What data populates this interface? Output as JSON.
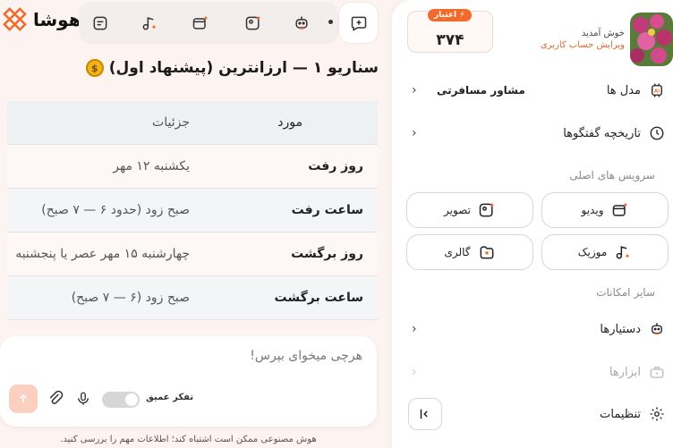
{
  "brand": {
    "name": "هوشا",
    "accent": "#f26a2b"
  },
  "toolbar": {
    "icons": [
      "chat-plus-icon",
      "robot-icon",
      "image-sparkle-icon",
      "video-sparkle-icon",
      "music-sparkle-icon",
      "notes-icon"
    ]
  },
  "scenario": {
    "title": "سناریو ۱ — ارزانترین (پیشنهاد اول)"
  },
  "table": {
    "headers": {
      "item": "مورد",
      "detail": "جزئیات"
    },
    "rows": [
      {
        "item": "روز رفت",
        "detail": "یکشنبه ۱۲ مهر"
      },
      {
        "item": "ساعت رفت",
        "detail": "صبح زود (حدود ۶ — ۷ صبح)"
      },
      {
        "item": "روز برگشت",
        "detail": "چهارشنبه ۱۵ مهر عصر یا پنجشنبه"
      },
      {
        "item": "ساعت برگشت",
        "detail": "صبح زود (۶ — ۷ صبح)"
      }
    ]
  },
  "composer": {
    "placeholder": "هرچی میخوای بپرس!",
    "deep_think_label": "تفکر عمیق"
  },
  "disclaimer": "هوش مصنوعی ممکن است اشتباه کند؛ اطلاعات مهم را بررسی کنید.",
  "sidebar": {
    "welcome": "خوش آمدید",
    "edit_account": "ویرایش حساب کاربری",
    "credit_label": "اعتبار",
    "credit_value": "۳۷۴",
    "models_label": "مدل ها",
    "models_selected": "مشاور مسافرتی",
    "history_label": "تاریخچه گفتگوها",
    "main_services_label": "سرویس های اصلی",
    "services": {
      "video": "ویدیو",
      "image": "تصویر",
      "music": "موزیک",
      "gallery": "گالری"
    },
    "other_label": "سایر امکانات",
    "assistants_label": "دستیارها",
    "tools_label": "ابزارها",
    "settings_label": "تنظیمات"
  }
}
